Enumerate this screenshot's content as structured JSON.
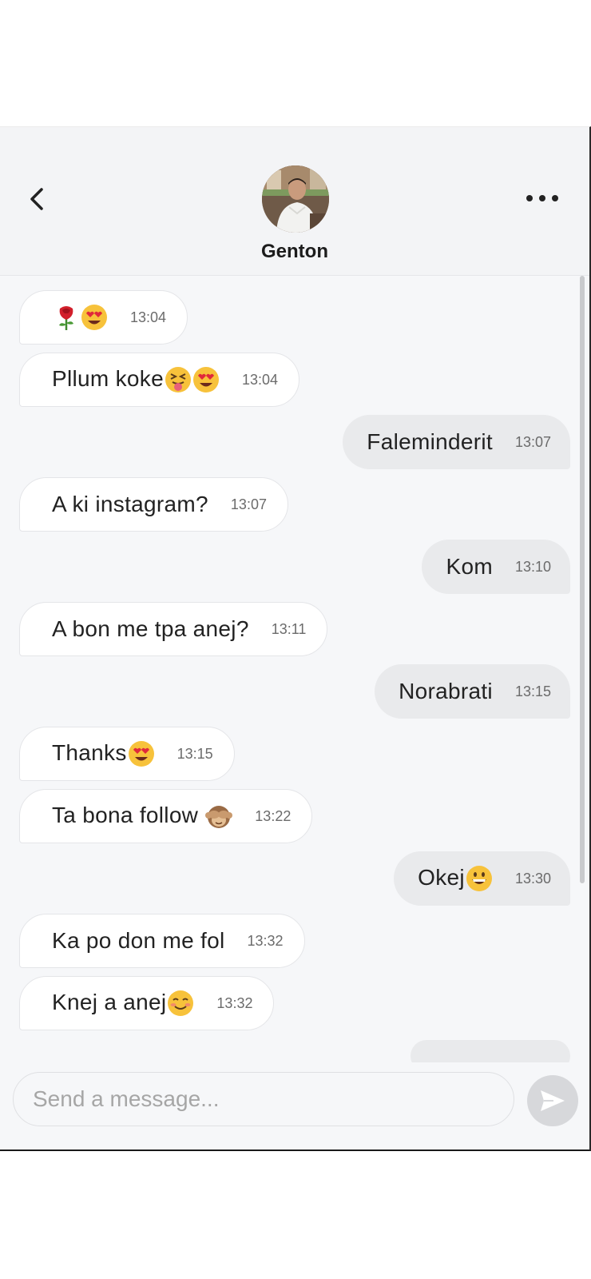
{
  "header": {
    "contact_name": "Genton"
  },
  "messages": [
    {
      "dir": "in",
      "text": "",
      "emojis": [
        "rose",
        "heart-eyes"
      ],
      "time": "13:04"
    },
    {
      "dir": "in",
      "text": "Pllum koke",
      "emojis": [
        "squint-tongue",
        "heart-eyes"
      ],
      "time": "13:04"
    },
    {
      "dir": "out",
      "text": "Faleminderit",
      "emojis": [],
      "time": "13:07"
    },
    {
      "dir": "in",
      "text": "A ki instagram?",
      "emojis": [],
      "time": "13:07"
    },
    {
      "dir": "out",
      "text": "Kom",
      "emojis": [],
      "time": "13:10"
    },
    {
      "dir": "in",
      "text": "A bon me tpa anej?",
      "emojis": [],
      "time": "13:11"
    },
    {
      "dir": "out",
      "text": "Norabrati",
      "emojis": [],
      "time": "13:15"
    },
    {
      "dir": "in",
      "text": "Thanks",
      "emojis": [
        "heart-eyes"
      ],
      "time": "13:15"
    },
    {
      "dir": "in",
      "text": "Ta bona follow ",
      "emojis": [
        "see-no-evil-monkey"
      ],
      "time": "13:22"
    },
    {
      "dir": "out",
      "text": "Okej",
      "emojis": [
        "grinning"
      ],
      "time": "13:30"
    },
    {
      "dir": "in",
      "text": "Ka po don me fol",
      "emojis": [],
      "time": "13:32"
    },
    {
      "dir": "in",
      "text": "Knej a anej",
      "emojis": [
        "smiling-blush"
      ],
      "time": "13:32"
    }
  ],
  "composer": {
    "placeholder": "Send a message..."
  },
  "colors": {
    "incoming_bubble": "#ffffff",
    "outgoing_bubble": "#e9eaec",
    "background": "#f6f7f9"
  }
}
